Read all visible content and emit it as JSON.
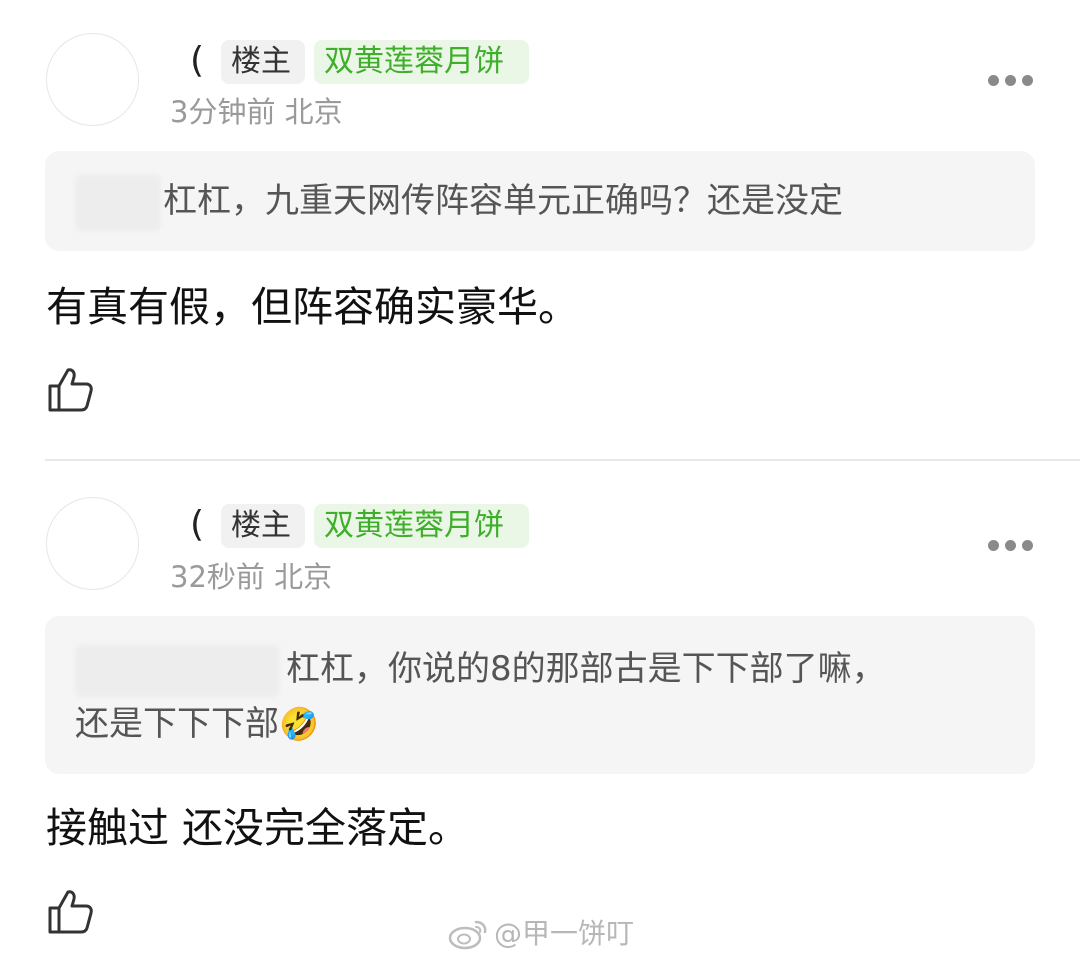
{
  "comments": [
    {
      "name": "(",
      "op_badge": "楼主",
      "medal_badge": "双黄莲蓉月饼",
      "time": "3分钟前",
      "location": "北京",
      "quote": "杠杠，九重天网传阵容单元正确吗？还是没定",
      "body": "有真有假，但阵容确实豪华。"
    },
    {
      "name": "(",
      "op_badge": "楼主",
      "medal_badge": "双黄莲蓉月饼",
      "time": "32秒前",
      "location": "北京",
      "quote": "杠杠，你说的8的那部古是下下部了嘛，",
      "quote_line2": "还是下下下部",
      "quote_emoji": "🤣",
      "body": "接触过 还没完全落定。"
    }
  ],
  "icons": {
    "more": "more-horizontal-icon",
    "like": "thumbs-up-icon",
    "watermark": "weibo-logo-icon"
  },
  "colors": {
    "medal_bg": "#eaf7e6",
    "medal_text": "#3fae2a",
    "meta_text": "#9a9a9a",
    "quote_bg": "#f5f5f5"
  },
  "watermark": "@甲一饼叮"
}
